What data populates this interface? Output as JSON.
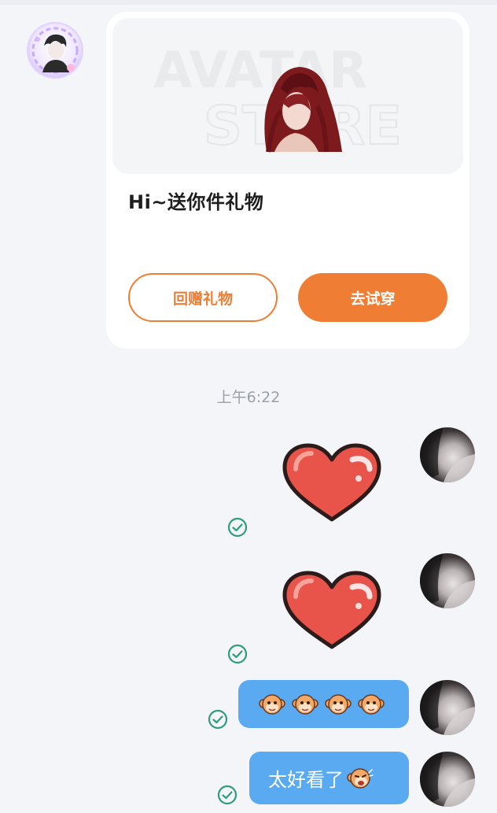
{
  "gift_card": {
    "banner_watermark_line1": "AVATAR",
    "banner_watermark_line2": "STORE",
    "title": "Hi~送你件礼物",
    "return_gift_label": "回赠礼物",
    "try_on_label": "去试穿"
  },
  "timestamp": "上午6:22",
  "messages": [
    {
      "type": "sticker",
      "sticker": "heart-sticker",
      "status": "read"
    },
    {
      "type": "sticker",
      "sticker": "heart-sticker",
      "status": "read"
    },
    {
      "type": "emoji",
      "emoji": [
        "monkey-emoji",
        "monkey-emoji",
        "monkey-emoji",
        "monkey-emoji"
      ],
      "status": "read"
    },
    {
      "type": "text",
      "text": "太好看了",
      "emoji": "monkey-laugh-emoji",
      "status": "read"
    }
  ],
  "colors": {
    "accent_orange": "#ef7d34",
    "bubble_blue": "#5aaaf2",
    "read_check_green": "#2f9c7d",
    "background": "#f3f5f8"
  }
}
